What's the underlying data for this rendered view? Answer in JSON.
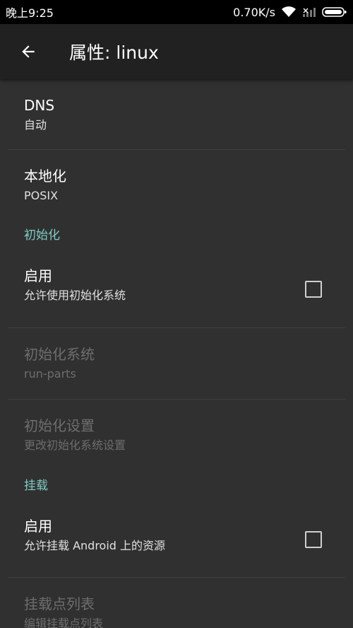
{
  "status_bar": {
    "time": "晚上9:25",
    "network_speed": "0.70K/s",
    "icons": [
      "wifi-icon",
      "signal-icon",
      "battery-icon"
    ]
  },
  "app_bar": {
    "back_icon": "arrow-back-icon",
    "title": "属性: linux"
  },
  "colors": {
    "background": "#303030",
    "app_bar": "#212121",
    "accent": "#80cbc4",
    "disabled_text": "#6d6d6d"
  },
  "prefs": {
    "dns": {
      "title": "DNS",
      "summary": "自动"
    },
    "locale": {
      "title": "本地化",
      "summary": "POSIX"
    },
    "init_category": "初始化",
    "init_enable": {
      "title": "启用",
      "summary": "允许使用初始化系统",
      "checked": false
    },
    "init_system": {
      "title": "初始化系统",
      "summary": "run-parts",
      "enabled": false
    },
    "init_settings": {
      "title": "初始化设置",
      "summary": "更改初始化系统设置",
      "enabled": false
    },
    "mount_category": "挂载",
    "mount_enable": {
      "title": "启用",
      "summary": "允许挂载 Android 上的资源",
      "checked": false
    },
    "mount_points": {
      "title": "挂载点列表",
      "summary": "编辑挂载点列表",
      "enabled": false
    }
  }
}
